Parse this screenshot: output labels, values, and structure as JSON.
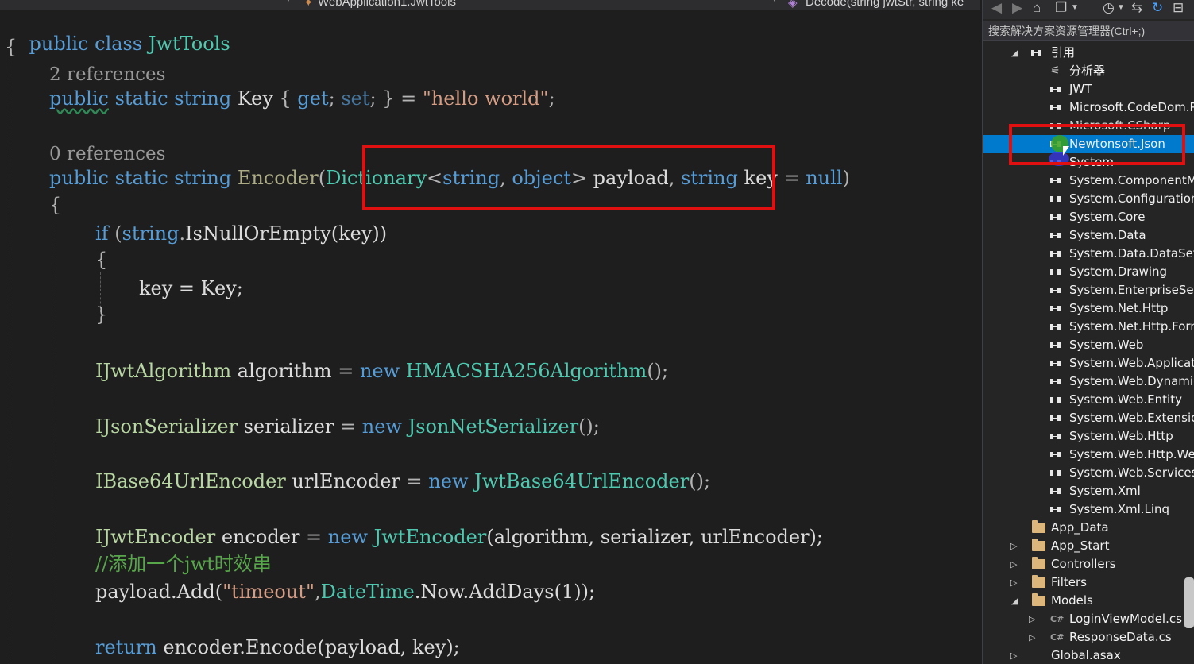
{
  "navbar": {
    "left": "",
    "middle": "WebApplication1.JwtTools",
    "right": "Decode(string jwtStr, string ke"
  },
  "code": {
    "class_kw": "public class",
    "class_name": "JwtTools",
    "brace_open": "{",
    "refs_2": "2 references",
    "refs_0": "0 references",
    "l_key_public": "public",
    "l_key_rest1": " static string ",
    "l_key_name": "Key",
    "l_key_p1": " { ",
    "l_key_get": "get",
    "l_key_p2": "; ",
    "l_key_set": "set",
    "l_key_p3": "; } = ",
    "l_key_str": "\"hello world\"",
    "l_key_end": ";",
    "l_enc_kw": "public static string ",
    "l_enc_name": "Encoder",
    "l_enc_p": "(",
    "l_enc_t1": "Dictionary",
    "l_enc_lt": "<",
    "l_enc_t2": "string",
    "l_enc_c": ", ",
    "l_enc_t3": "object",
    "l_enc_gt": "> ",
    "l_enc_arg1": "payload",
    "l_enc_c2": ", ",
    "l_enc_t4": "string",
    "l_enc_arg2": " key",
    "l_enc_eq": " = ",
    "l_enc_null": "null",
    "l_enc_close": ")",
    "brace_m_open": "{",
    "l_if_kw": "if",
    "l_if_p": " (",
    "l_if_str": "string",
    "l_if_dot": ".",
    "l_if_m": "IsNullOrEmpty",
    "l_if_arg": "(key))",
    "brace_if_open": "{",
    "l_assign": "key = Key;",
    "brace_if_close": "}",
    "l_alg_t": "IJwtAlgorithm",
    "l_alg_v": " algorithm",
    "l_alg_eq": " = ",
    "l_alg_new": "new",
    "l_alg_c": " HMACSHA256Algorithm",
    "l_alg_end": "();",
    "l_ser_t": "IJsonSerializer",
    "l_ser_v": " serializer",
    "l_ser_eq": " = ",
    "l_ser_new": "new",
    "l_ser_c": " JsonNetSerializer",
    "l_ser_end": "();",
    "l_url_t": "IBase64UrlEncoder",
    "l_url_v": " urlEncoder",
    "l_url_eq": " = ",
    "l_url_new": "new",
    "l_url_c": " JwtBase64UrlEncoder",
    "l_url_end": "();",
    "l_je_t": "IJwtEncoder",
    "l_je_v": " encoder",
    "l_je_eq": " = ",
    "l_je_new": "new",
    "l_je_c": " JwtEncoder",
    "l_je_args": "(algorithm, serializer, urlEncoder);",
    "l_comment": "//添加一个jwt时效串",
    "l_pay_v": "payload",
    "l_pay_m": ".Add(",
    "l_pay_str": "\"timeout\"",
    "l_pay_c": ",",
    "l_pay_dt": "DateTime",
    "l_pay_rest": ".Now.AddDays(1));",
    "l_ret_kw": "return",
    "l_ret_rest": " encoder.Encode(payload, key);"
  },
  "solution_explorer": {
    "search_placeholder": "搜索解决方案资源管理器(Ctrl+;)",
    "items": [
      {
        "label": "引用"
      },
      {
        "label": "分析器"
      },
      {
        "label": "JWT"
      },
      {
        "label": "Microsoft.CodeDom.P"
      },
      {
        "label": "Microsoft.CSharp"
      },
      {
        "label": "Newtonsoft.Json"
      },
      {
        "label": "System"
      },
      {
        "label": "System.ComponentM"
      },
      {
        "label": "System.Configuration"
      },
      {
        "label": "System.Core"
      },
      {
        "label": "System.Data"
      },
      {
        "label": "System.Data.DataSetE"
      },
      {
        "label": "System.Drawing"
      },
      {
        "label": "System.EnterpriseServ"
      },
      {
        "label": "System.Net.Http"
      },
      {
        "label": "System.Net.Http.Form"
      },
      {
        "label": "System.Web"
      },
      {
        "label": "System.Web.Applicati"
      },
      {
        "label": "System.Web.Dynamic"
      },
      {
        "label": "System.Web.Entity"
      },
      {
        "label": "System.Web.Extensio"
      },
      {
        "label": "System.Web.Http"
      },
      {
        "label": "System.Web.Http.We"
      },
      {
        "label": "System.Web.Services"
      },
      {
        "label": "System.Xml"
      },
      {
        "label": "System.Xml.Linq"
      },
      {
        "label": "App_Data"
      },
      {
        "label": "App_Start"
      },
      {
        "label": "Controllers"
      },
      {
        "label": "Filters"
      },
      {
        "label": "Models"
      },
      {
        "label": "LoginViewModel.cs"
      },
      {
        "label": "ResponseData.cs"
      },
      {
        "label": "Global.asax"
      }
    ]
  },
  "colors": {
    "editor_bg": "#1e1e1e",
    "selection_blue": "#007acc",
    "annotation_red": "#e01010",
    "keyword": "#569cd6",
    "type": "#4ec9b0",
    "string": "#d69d85"
  }
}
